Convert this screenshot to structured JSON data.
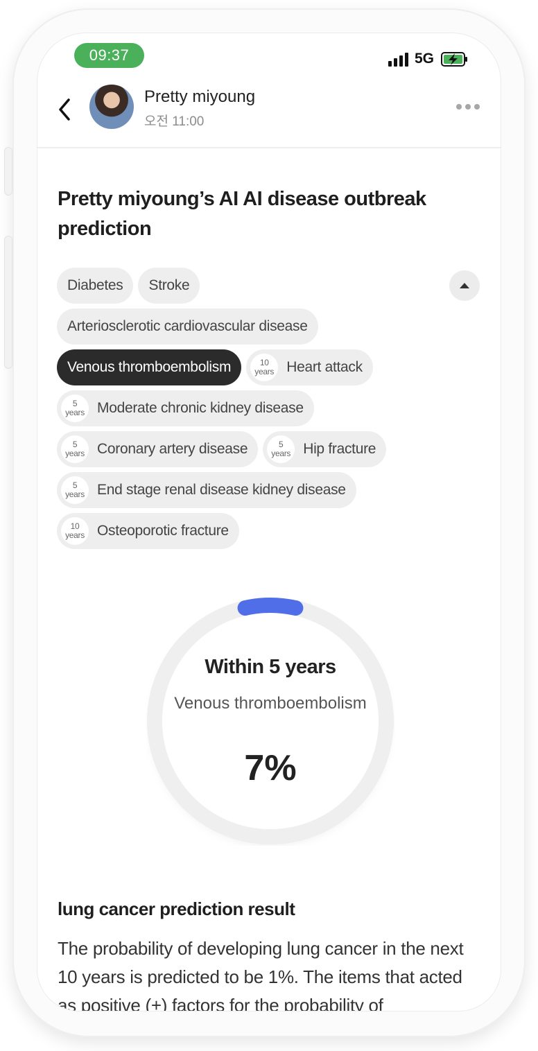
{
  "status_bar": {
    "time": "09:37",
    "network": "5G"
  },
  "header": {
    "name": "Pretty miyoung",
    "subtitle": "오전 11:00"
  },
  "title": "Pretty miyoung’s AI AI disease outbreak prediction",
  "chips": {
    "row1": [
      {
        "label": "Diabetes"
      },
      {
        "label": "Stroke"
      }
    ],
    "row2": [
      {
        "label": "Arteriosclerotic cardiovascular disease"
      }
    ],
    "row3": [
      {
        "label": "Venous thromboembolism",
        "active": true
      },
      {
        "label": "Heart attack",
        "badge_num": "10",
        "badge_unit": "years"
      }
    ],
    "row4": [
      {
        "label": "Moderate chronic kidney disease",
        "badge_num": "5",
        "badge_unit": "years"
      }
    ],
    "row5": [
      {
        "label": "Coronary artery disease",
        "badge_num": "5",
        "badge_unit": "years"
      },
      {
        "label": "Hip fracture",
        "badge_num": "5",
        "badge_unit": "years"
      }
    ],
    "row6": [
      {
        "label": "End stage renal disease kidney disease",
        "badge_num": "5",
        "badge_unit": "years"
      }
    ],
    "row7": [
      {
        "label": "Osteoporotic fracture",
        "badge_num": "10",
        "badge_unit": "years"
      }
    ]
  },
  "gauge": {
    "title": "Within 5 years",
    "disease": "Venous thromboembolism",
    "value_label": "7%",
    "percent": 7,
    "track_color": "#efefef",
    "arc_color": "#4f6ee8"
  },
  "result": {
    "title": "lung cancer prediction result",
    "text": "The probability of developing lung cancer in the next 10 years is predicted to be 1%. The items that acted as positive (+) factors for the probability of"
  },
  "colors": {
    "time_pill": "#4ab05a",
    "active_chip": "#2b2b2b",
    "chip": "#eeeeee"
  }
}
